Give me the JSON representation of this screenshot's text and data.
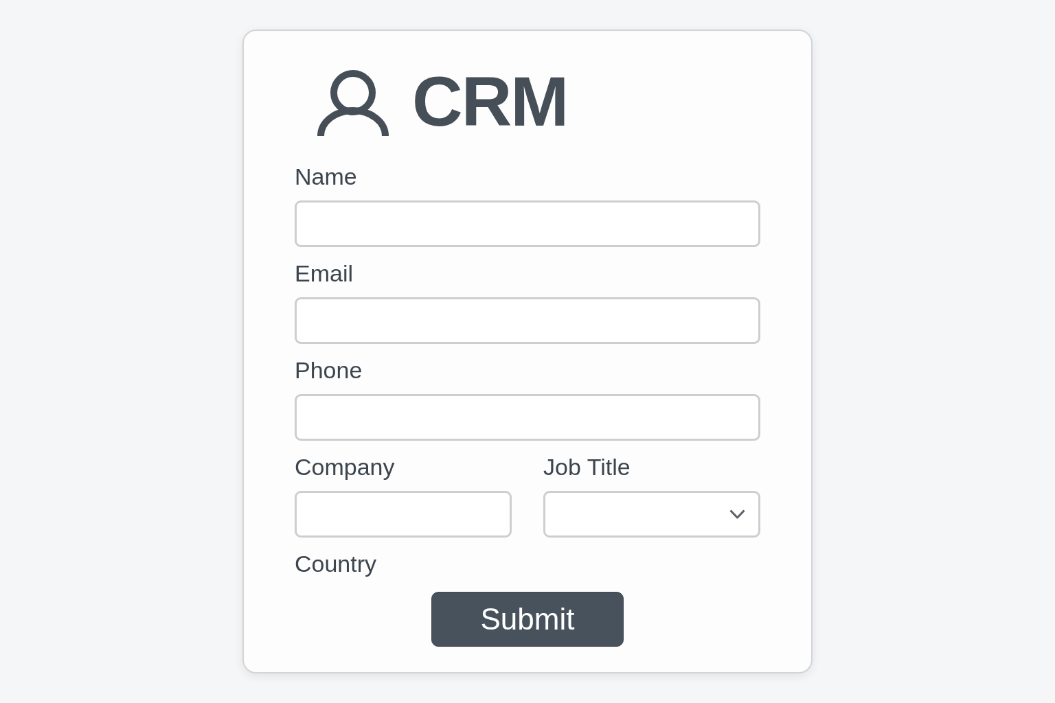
{
  "header": {
    "title": "CRM"
  },
  "fields": [
    {
      "label": "Name",
      "kind": "text"
    },
    {
      "label": "Email",
      "kind": "text"
    },
    {
      "label": "Phone",
      "kind": "text"
    }
  ],
  "field_pair": [
    {
      "label": "Company",
      "kind": "text"
    },
    {
      "label": "Job Title",
      "kind": "select"
    }
  ],
  "country": {
    "label": "Country"
  },
  "submit_button": {
    "label": "Submit"
  }
}
